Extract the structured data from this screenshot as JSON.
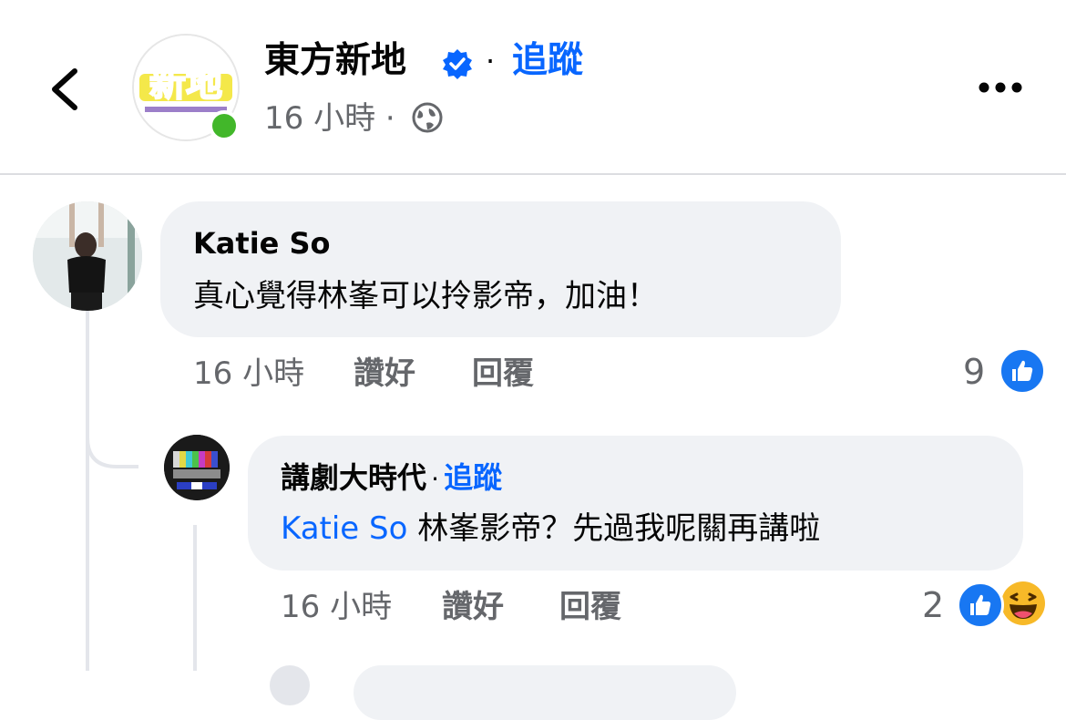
{
  "header": {
    "page_name": "東方新地",
    "separator": "·",
    "follow_label": "追蹤",
    "post_time": "16 小時 ·",
    "avatar_logo_text": "新地"
  },
  "comments": [
    {
      "author": "Katie So",
      "text": "真心覺得林峯可以拎影帝，加油！",
      "time": "16 小時",
      "like_label": "讚好",
      "reply_label": "回覆",
      "reaction_count": "9",
      "reactions": [
        "like-icon"
      ]
    },
    {
      "author": "講劇大時代",
      "separator": "·",
      "follow_label": "追蹤",
      "mention": "Katie So",
      "text": "林峯影帝？先過我呢關再講啦",
      "time": "16 小時",
      "like_label": "讚好",
      "reply_label": "回覆",
      "reaction_count": "2",
      "reactions": [
        "like-icon",
        "laughing-face-icon"
      ]
    }
  ],
  "colors": {
    "accent": "#0866ff",
    "secondary_text": "#65676b",
    "bubble_bg": "#f0f2f5",
    "online": "#42b72a",
    "like_blue": "#1877f2"
  }
}
